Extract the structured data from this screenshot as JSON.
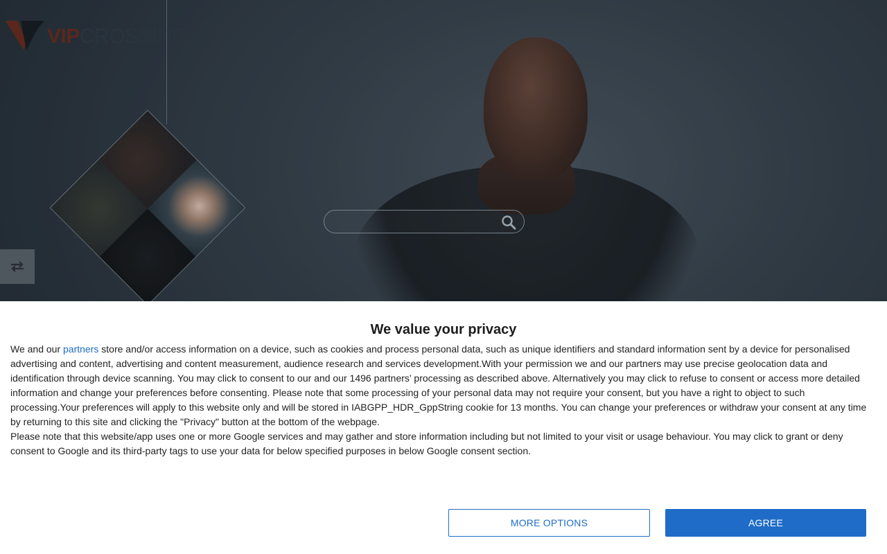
{
  "site": {
    "logo": {
      "part1": "VIP",
      "part2": "CROSSING"
    },
    "search": {
      "value": "",
      "placeholder": ""
    },
    "icons": {
      "search": "search-icon",
      "swap": "swap-arrows-icon"
    }
  },
  "consent": {
    "title": "We value your privacy",
    "intro_before_link": "We and our ",
    "partners_link": "partners",
    "intro_after_link": " store and/or access information on a device, such as cookies and process personal data, such as unique identifiers and standard information sent by a device for personalised advertising and content, advertising and content measurement, audience research and services development.With your permission we and our partners may use precise geolocation data and identification through device scanning. You may click to consent to our and our 1496 partners’ processing as described above. Alternatively you may click to refuse to consent or access more detailed information and change your preferences before consenting. Please note that some processing of your personal data may not require your consent, but you have a right to object to such processing.Your preferences will apply to this website only and will be stored in IABGPP_HDR_GppString cookie for 13 months. You can change your preferences or withdraw your consent at any time by returning to this site and clicking the \"Privacy\" button at the bottom of the webpage.",
    "google_notice": "Please note that this website/app uses one or more Google services and may gather and store information including but not limited to your visit or usage behaviour. You may click to grant or deny consent to Google and its third-party tags to use your data for below specified purposes in below Google consent section.",
    "more_options_label": "MORE OPTIONS",
    "agree_label": "AGREE"
  },
  "colors": {
    "accent": "#1e6cc8",
    "logo_vip": "#6b2a1c",
    "panel_bg": "#ffffff"
  }
}
